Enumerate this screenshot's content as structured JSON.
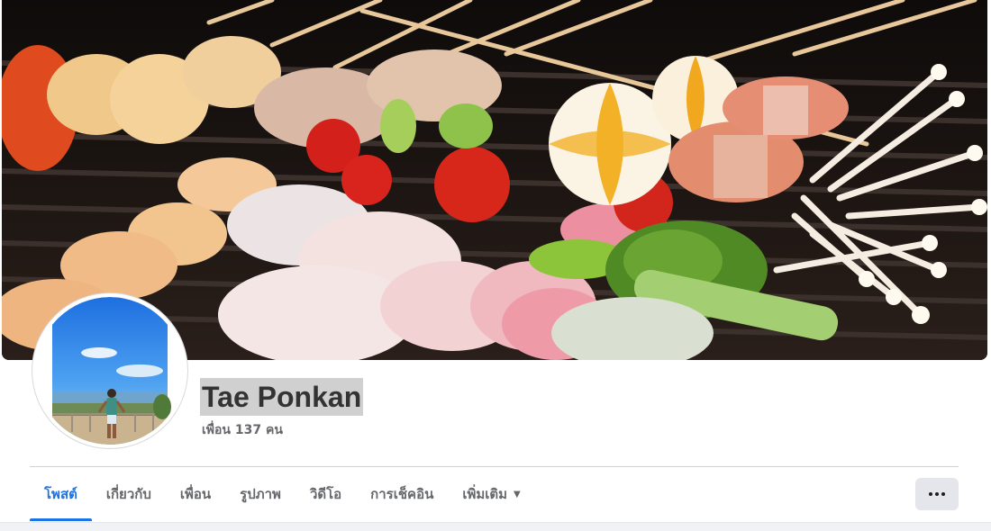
{
  "profile": {
    "name": "Tae Ponkan",
    "friends": "เพื่อน 137 คน"
  },
  "tabs": [
    {
      "label": "โพสต์",
      "active": true
    },
    {
      "label": "เกี่ยวกับ",
      "active": false
    },
    {
      "label": "เพื่อน",
      "active": false
    },
    {
      "label": "รูปภาพ",
      "active": false
    },
    {
      "label": "วิดีโอ",
      "active": false
    },
    {
      "label": "การเช็คอิน",
      "active": false
    },
    {
      "label": "เพิ่มเติม",
      "active": false
    }
  ],
  "icons": {
    "more_caret": "caret-down-icon",
    "overflow": "more-options-icon"
  },
  "colors": {
    "accent": "#1b74e4",
    "tab_text": "#65676b",
    "name_text": "#333333",
    "button_bg": "#e4e6eb"
  }
}
